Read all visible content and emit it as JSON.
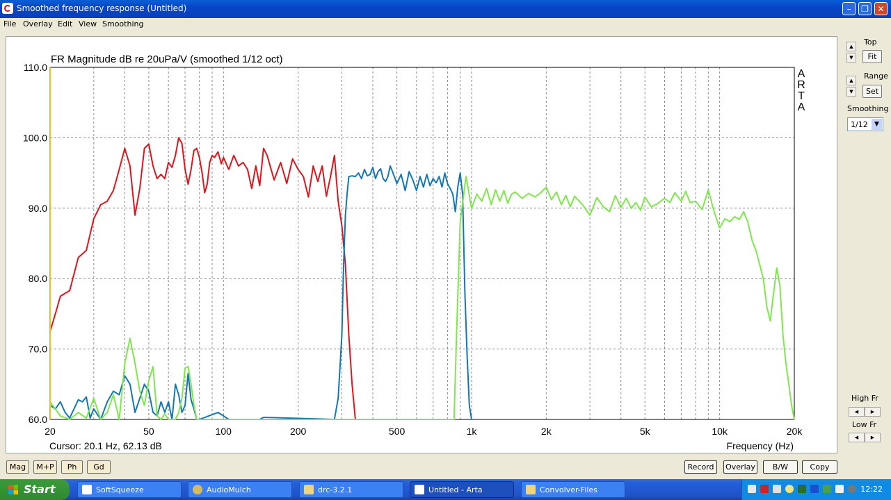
{
  "window": {
    "title": "Smoothed frequency response (Untitled)"
  },
  "menu": [
    "File",
    "Overlay",
    "Edit",
    "View",
    "Smoothing"
  ],
  "side_panel": {
    "top_label": "Top",
    "fit_label": "Fit",
    "range_label": "Range",
    "set_label": "Set",
    "smoothing_label": "Smoothing",
    "smoothing_value": "1/12",
    "high_fr_label": "High Fr",
    "low_fr_label": "Low Fr"
  },
  "bottom_left_buttons": [
    "Mag",
    "M+P",
    "Ph",
    "Gd"
  ],
  "bottom_right_buttons": [
    "Record",
    "Overlay",
    "B/W",
    "Copy"
  ],
  "status": {
    "cursor": "Cursor: 20.1 Hz, 62.13 dB"
  },
  "chart_data": {
    "type": "line",
    "title": "FR Magnitude dB re 20uPa/V (smoothed 1/12 oct)",
    "xlabel": "Frequency (Hz)",
    "watermark": [
      "A",
      "R",
      "T",
      "A"
    ],
    "x_scale": "log",
    "xlim": [
      20,
      20000
    ],
    "ylim": [
      60,
      110
    ],
    "grid": true,
    "x_tick_labels": [
      "20",
      "50",
      "100",
      "200",
      "500",
      "1k",
      "2k",
      "5k",
      "10k",
      "20k"
    ],
    "x_tick_values": [
      20,
      50,
      100,
      200,
      500,
      1000,
      2000,
      5000,
      10000,
      20000
    ],
    "y_tick_labels": [
      "110.0",
      "100.0",
      "90.0",
      "80.0",
      "70.0",
      "60.0"
    ],
    "y_tick_values": [
      110,
      100,
      90,
      80,
      70,
      60
    ],
    "series": [
      {
        "color": "#e0141a",
        "x": [
          20,
          21,
          22,
          24,
          26,
          28,
          30,
          32,
          34,
          36,
          38,
          40,
          42,
          44,
          46,
          48,
          50,
          52,
          54,
          56,
          58,
          60,
          62,
          64,
          66,
          68,
          70,
          72,
          74,
          76,
          78,
          80,
          82,
          84,
          86,
          88,
          90,
          92,
          95,
          98,
          100,
          105,
          110,
          115,
          120,
          125,
          130,
          135,
          140,
          145,
          150,
          160,
          170,
          180,
          190,
          200,
          210,
          220,
          230,
          240,
          250,
          260,
          270,
          280,
          290,
          300,
          310,
          320,
          330,
          340
        ],
        "y": [
          72.5,
          75,
          77.5,
          78.3,
          83,
          84,
          88.5,
          90.5,
          91,
          92.5,
          95.5,
          98.5,
          96,
          89,
          92.8,
          98.5,
          99.1,
          96,
          94.2,
          94.8,
          94.2,
          96.5,
          95.8,
          97.5,
          100,
          99.2,
          95.5,
          93.4,
          95.5,
          98.2,
          98.5,
          97.2,
          95,
          92.2,
          93.4,
          96.5,
          97.5,
          97.2,
          98,
          96.3,
          97.2,
          95.5,
          97.5,
          96,
          96.5,
          95.5,
          92.8,
          96,
          93.2,
          98.5,
          97.5,
          94,
          96.5,
          93.5,
          97,
          95.5,
          94.5,
          91.6,
          96,
          93.8,
          96,
          91.7,
          94.5,
          97.5,
          91,
          87.5,
          82,
          72,
          65,
          60
        ]
      },
      {
        "color": "#1177b6",
        "x": [
          20,
          21,
          22,
          23,
          24,
          26,
          27,
          28,
          29,
          30,
          32,
          34,
          36,
          38,
          40,
          42,
          44,
          46,
          48,
          50,
          52,
          54,
          56,
          58,
          60,
          62,
          64,
          66,
          68,
          70,
          72,
          74,
          76,
          78,
          80,
          95,
          100,
          105,
          140,
          145,
          280,
          290,
          300,
          305,
          310,
          315,
          320,
          330,
          340,
          350,
          360,
          370,
          380,
          390,
          400,
          410,
          420,
          430,
          440,
          450,
          460,
          470,
          480,
          500,
          520,
          540,
          560,
          580,
          600,
          620,
          640,
          660,
          680,
          700,
          720,
          740,
          760,
          780,
          800,
          820,
          840,
          860,
          880,
          900,
          920,
          940,
          960,
          980,
          1000
        ],
        "y": [
          62,
          61.5,
          62.5,
          61,
          60.2,
          62.8,
          62.5,
          63.2,
          60.2,
          61.5,
          60,
          62.5,
          64,
          63.5,
          66.2,
          65,
          61,
          63,
          65,
          64,
          61,
          60.5,
          62.5,
          61,
          62.5,
          60,
          65,
          63.5,
          61,
          62,
          66.5,
          62.8,
          61.5,
          60,
          60,
          61,
          60.5,
          60,
          60,
          60.3,
          60,
          63,
          72,
          82,
          89,
          92,
          94.5,
          94.6,
          94.5,
          95,
          94.2,
          95.5,
          94.6,
          94.8,
          95.8,
          94.2,
          95.2,
          95.6,
          94.2,
          93.8,
          94.5,
          96,
          95.2,
          93.5,
          94.8,
          92.5,
          95.2,
          94,
          92.5,
          94.5,
          93,
          94.8,
          93.2,
          94.2,
          93.6,
          94.5,
          93,
          95,
          93.5,
          92.8,
          92,
          89.5,
          93,
          95,
          92,
          78,
          69,
          62,
          60
        ]
      },
      {
        "color": "#7ee84a",
        "x": [
          20,
          22,
          24,
          26,
          28,
          30,
          32,
          34,
          36,
          38,
          40,
          42,
          44,
          46,
          48,
          50,
          52,
          54,
          56,
          58,
          60,
          62,
          64,
          66,
          68,
          70,
          72,
          74,
          76,
          78,
          80,
          82,
          850,
          870,
          900,
          950,
          1000,
          1050,
          1100,
          1150,
          1200,
          1250,
          1300,
          1350,
          1400,
          1450,
          1500,
          1600,
          1700,
          1800,
          1900,
          2000,
          2100,
          2200,
          2300,
          2400,
          2500,
          2600,
          2800,
          3000,
          3200,
          3400,
          3600,
          3800,
          4000,
          4200,
          4400,
          4600,
          4800,
          5000,
          5300,
          5600,
          6000,
          6300,
          6600,
          7000,
          7300,
          7600,
          8000,
          8500,
          9000,
          9500,
          10000,
          10500,
          11000,
          11500,
          12000,
          12500,
          13000,
          13500,
          14000,
          14500,
          15000,
          15500,
          16000,
          16500,
          17000,
          17500,
          18000,
          18500,
          19000,
          19500,
          20000
        ],
        "y": [
          62.5,
          60.5,
          60,
          61,
          60.2,
          63,
          60,
          61,
          63.5,
          60,
          68,
          71.5,
          68,
          64,
          62,
          65.5,
          67.5,
          60.5,
          60,
          60.8,
          60,
          60,
          60,
          61,
          63,
          67.3,
          67.5,
          65,
          62,
          60,
          60,
          60,
          60,
          72,
          88,
          94.5,
          90,
          92,
          91,
          92.8,
          90.5,
          92.6,
          91,
          92.5,
          90.7,
          92,
          92.3,
          91.4,
          92.1,
          91.6,
          92.2,
          93,
          91.2,
          92.3,
          90.5,
          91.8,
          90.2,
          91.7,
          90.5,
          89,
          91.5,
          90.2,
          89.5,
          91.8,
          90.1,
          91.4,
          90,
          90.8,
          89.7,
          91.6,
          90.2,
          90.6,
          91.4,
          90.8,
          92.2,
          91,
          92.4,
          90.8,
          91,
          89.8,
          92.6,
          89.5,
          87.2,
          88.5,
          88.1,
          88.8,
          88.4,
          89.5,
          88,
          85.5,
          84,
          82,
          80,
          76,
          74,
          78,
          81.5,
          79,
          72,
          68,
          65,
          62,
          60
        ]
      }
    ]
  },
  "taskbar": {
    "start_label": "Start",
    "tasks": [
      "SoftSqueeze",
      "AudioMulch",
      "drc-3.2.1",
      "Untitled - Arta",
      "Convolver-Files"
    ],
    "clock": "12:22"
  }
}
